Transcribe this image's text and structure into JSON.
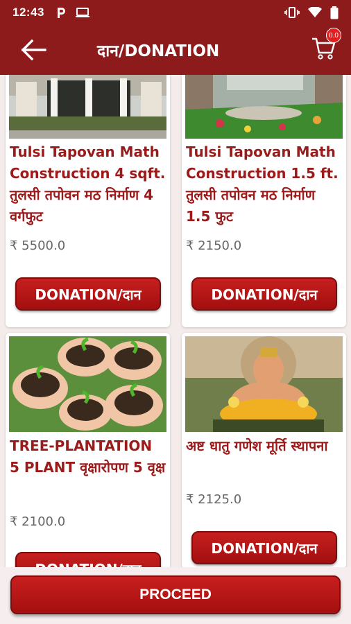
{
  "status_bar": {
    "time": "12:43",
    "icons": [
      "parking-icon",
      "laptop-icon",
      "vibrate-icon",
      "wifi-icon",
      "battery-icon"
    ]
  },
  "app_bar": {
    "title": "दान/DONATION",
    "cart_count": "0.0",
    "back_icon": "arrow-left-icon",
    "cart_icon": "cart-icon"
  },
  "products": [
    {
      "title": "Tulsi Tapovan Math Construction 4 sqft. तुलसी तपोवन मठ निर्माण 4 वर्गफुट",
      "price": "₹ 5500.0",
      "button": "DONATION/दान",
      "image": "temple-gate-image"
    },
    {
      "title": "Tulsi Tapovan Math Construction 1.5 ft. तुलसी तपोवन मठ निर्माण 1.5 फुट",
      "price": "₹ 2150.0",
      "button": "DONATION/दान",
      "image": "garden-courtyard-image"
    },
    {
      "title": "TREE-PLANTATION 5 PLANT वृक्षारोपण 5 वृक्ष",
      "price": "₹ 2100.0",
      "button": "DONATION/दान",
      "image": "hands-holding-saplings-image"
    },
    {
      "title": "अष्ट धातु गणेश मूर्ति स्थापना",
      "price": "₹ 2125.0",
      "button": "DONATION/दान",
      "image": "ganesha-idol-image"
    }
  ],
  "proceed_label": "PROCEED",
  "colors": {
    "primary": "#8e1b1b",
    "button": "#b51515",
    "title_text": "#9b1a1a"
  }
}
